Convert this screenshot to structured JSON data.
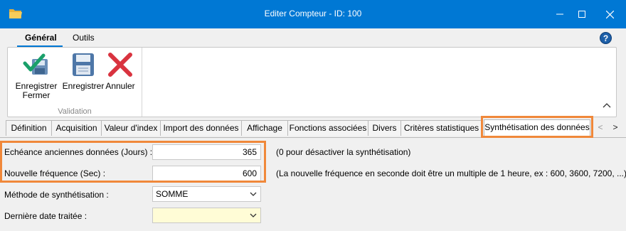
{
  "window": {
    "title": "Editer Compteur - ID: 100",
    "controls": [
      "minimize-icon",
      "maximize-icon",
      "close-icon"
    ]
  },
  "ribbon_tabs": [
    {
      "label": "Général",
      "active": true
    },
    {
      "label": "Outils",
      "active": false
    }
  ],
  "help": {
    "glyph": "?"
  },
  "ribbon": {
    "buttons": [
      {
        "label_line1": "Enregistrer",
        "label_line2": "Fermer",
        "icon": "save-close-icon"
      },
      {
        "label_line1": "Enregistrer",
        "label_line2": "",
        "icon": "save-icon"
      },
      {
        "label_line1": "Annuler",
        "label_line2": "",
        "icon": "cancel-icon"
      }
    ],
    "group_label": "Validation"
  },
  "tabs": [
    {
      "label": "Définition"
    },
    {
      "label": "Acquisition"
    },
    {
      "label": "Valeur d'index"
    },
    {
      "label": "Import des données"
    },
    {
      "label": "Affichage"
    },
    {
      "label": "Fonctions associées"
    },
    {
      "label": "Divers"
    },
    {
      "label": "Critères statistiques"
    },
    {
      "label": "Synthétisation des données",
      "active": true
    }
  ],
  "tab_scroll": {
    "left": "<",
    "right": ">"
  },
  "form": {
    "echeance": {
      "label": "Echéance anciennes données (Jours) :",
      "value": "365",
      "hint": "(0 pour désactiver la synthétisation)"
    },
    "frequence": {
      "label": "Nouvelle fréquence (Sec) :",
      "value": "600",
      "hint": "(La nouvelle fréquence en seconde doit être un multiple de 1 heure, ex : 600, 3600, 7200, ...)"
    },
    "methode": {
      "label": "Méthode de synthétisation :",
      "value": "SOMME"
    },
    "derniere_date": {
      "label": "Dernière date traitée :",
      "value": ""
    }
  },
  "colors": {
    "titlebar": "#0078d4",
    "highlight": "#f0883a",
    "date_field": "#fffcd6"
  }
}
